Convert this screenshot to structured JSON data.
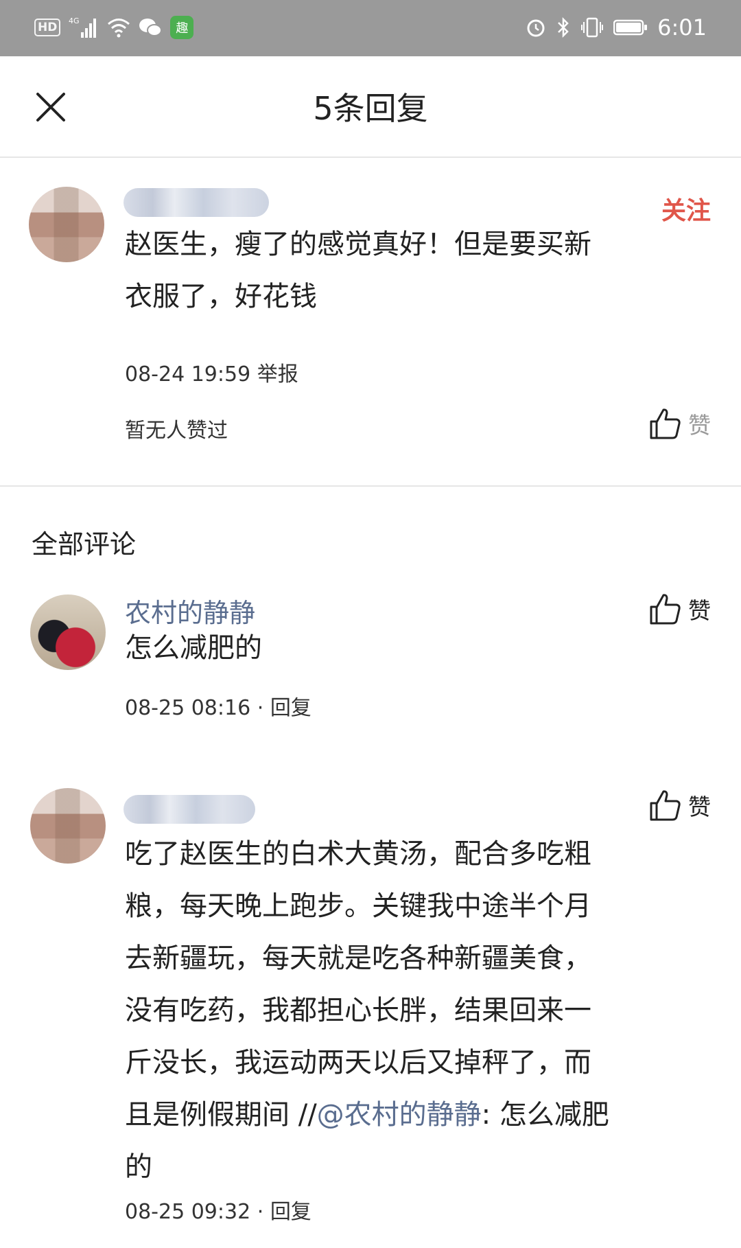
{
  "status_bar": {
    "left_icons": [
      "hd-icon",
      "signal-4g-icon",
      "wifi-icon",
      "wechat-icon",
      "app-qu-icon"
    ],
    "hd_label": "HD",
    "app_glyph": "趣",
    "right_icons": [
      "alarm-icon",
      "bluetooth-icon",
      "vibrate-icon",
      "battery-icon"
    ],
    "time": "6:01"
  },
  "header": {
    "title": "5条回复",
    "close_icon": "close-icon"
  },
  "main_comment": {
    "follow_label": "关注",
    "text_line1": "赵医生，瘦了的感觉真好！但是要买新",
    "text_line2": "衣服了，好花钱",
    "timestamp": "08-24 19:59",
    "report_label": "举报",
    "no_likes": "暂无人赞过",
    "like_label": "赞"
  },
  "section_title": "全部评论",
  "replies": [
    {
      "author": "农村的静静",
      "text": "怎么减肥的",
      "timestamp": "08-25 08:16",
      "sep": "·",
      "reply_label": "回复",
      "like_label": "赞"
    },
    {
      "text_lines": [
        "吃了赵医生的白术大黄汤，配合多吃粗",
        "粮，每天晚上跑步。关键我中途半个月",
        "去新疆玩，每天就是吃各种新疆美食，",
        "没有吃药，我都担心长胖，结果回来一",
        "斤没长，我运动两天以后又掉秤了，而"
      ],
      "line6_prefix": "且是例假期间 //",
      "mention": "@农村的静静",
      "line6_suffix": ": 怎么减肥",
      "line7": "的",
      "timestamp": "08-25 09:32",
      "sep": "·",
      "reply_label": "回复",
      "like_label": "赞"
    }
  ],
  "colors": {
    "accent_red": "#e0564a",
    "link_blue": "#5a6d8f",
    "statusbar_gray": "#9a9a9a"
  }
}
